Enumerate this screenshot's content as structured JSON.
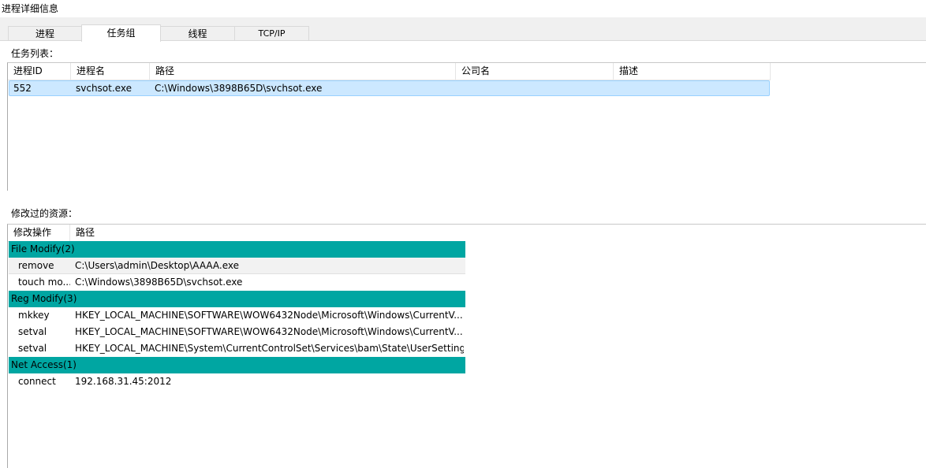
{
  "window": {
    "title": "进程详细信息"
  },
  "tabs": [
    {
      "label": "进程"
    },
    {
      "label": "任务组"
    },
    {
      "label": "线程"
    },
    {
      "label": "TCP/IP"
    }
  ],
  "active_tab": "任务组",
  "task_list": {
    "label": "任务列表：",
    "columns": [
      "进程ID",
      "进程名",
      "路径",
      "公司名",
      "描述"
    ],
    "rows": [
      {
        "pid": "552",
        "name": "svchsot.exe",
        "path": "C:\\Windows\\3898B65D\\svchsot.exe",
        "company": "",
        "desc": ""
      }
    ]
  },
  "modified": {
    "label": "修改过的资源：",
    "columns": [
      "修改操作",
      "路径"
    ],
    "groups": [
      {
        "title": "File Modify(2)",
        "rows": [
          {
            "op": "remove",
            "path": "C:\\Users\\admin\\Desktop\\AAAA.exe"
          },
          {
            "op": "touch mo...",
            "path": "C:\\Windows\\3898B65D\\svchsot.exe"
          }
        ]
      },
      {
        "title": "Reg Modify(3)",
        "rows": [
          {
            "op": "mkkey",
            "path": "HKEY_LOCAL_MACHINE\\SOFTWARE\\WOW6432Node\\Microsoft\\Windows\\CurrentV..."
          },
          {
            "op": "setval",
            "path": "HKEY_LOCAL_MACHINE\\SOFTWARE\\WOW6432Node\\Microsoft\\Windows\\CurrentV..."
          },
          {
            "op": "setval",
            "path": "HKEY_LOCAL_MACHINE\\System\\CurrentControlSet\\Services\\bam\\State\\UserSetting..."
          }
        ]
      },
      {
        "title": "Net Access(1)",
        "rows": [
          {
            "op": "connect",
            "path": "192.168.31.45:2012"
          }
        ]
      }
    ]
  },
  "colors": {
    "group_header": "#00a6a2",
    "selection": "#cce8ff",
    "selection_border": "#99d1ff"
  }
}
